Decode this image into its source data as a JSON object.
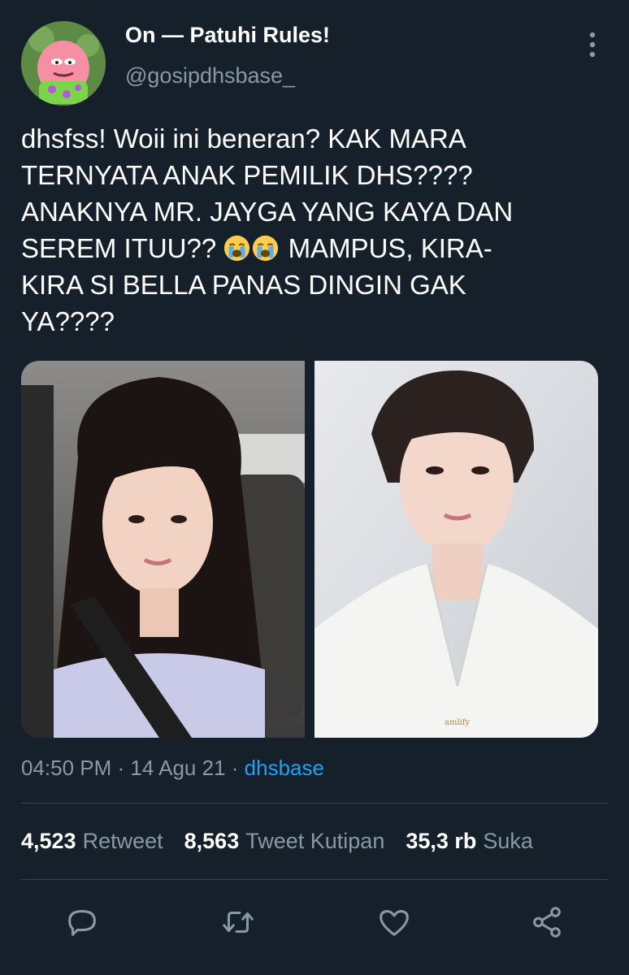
{
  "author": {
    "name": "On — Patuhi Rules!",
    "handle": "@gosipdhsbase_"
  },
  "tweet": {
    "lines": [
      "dhsfss! Woii ini beneran? KAK MARA",
      "TERNYATA ANAK PEMILIK DHS????",
      "ANAKNYA MR. JAYGA YANG KAYA DAN",
      "SEREM ITUU??",
      "MAMPUS, KIRA-",
      "KIRA SI BELLA PANAS DINGIN GAK",
      "YA????"
    ],
    "emoji": "loudly-crying-face",
    "image_watermark": "amlify"
  },
  "meta": {
    "time": "04:50 PM",
    "date": "14 Agu 21",
    "source": "dhsbase"
  },
  "stats": {
    "retweets": "4,523",
    "retweets_label": "Retweet",
    "quotes": "8,563",
    "quotes_label": "Tweet Kutipan",
    "likes": "35,3 rb",
    "likes_label": "Suka"
  },
  "actions": [
    "reply-icon",
    "retweet-icon",
    "like-icon",
    "share-icon"
  ],
  "colors": {
    "background": "#15202b",
    "text": "#ffffff",
    "muted": "#8899a6",
    "link": "#1da1f2",
    "divider": "#38444d"
  }
}
